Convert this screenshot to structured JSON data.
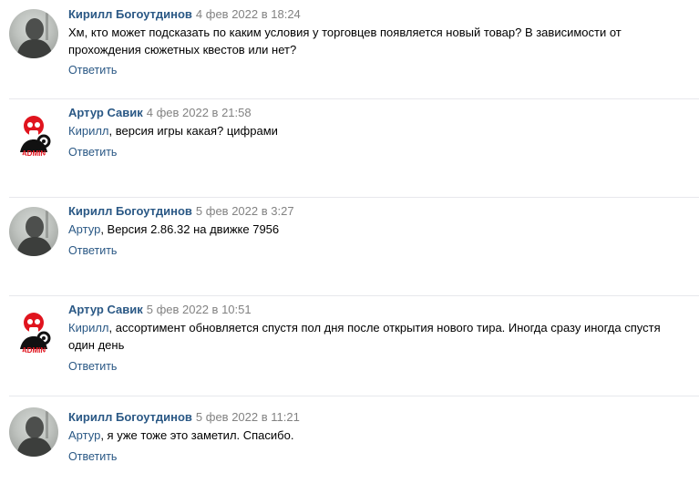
{
  "reply_label": "Ответить",
  "comments": [
    {
      "author": "Кирилл Богоутдинов",
      "date": "4 фев 2022 в 18:24",
      "mention": "",
      "text": "Хм, кто может подсказать по каким условия у торговцев появляется новый товар? В зависимости от прохождения сюжетных квестов или нет?",
      "avatar": "user-photo"
    },
    {
      "author": "Артур Савик",
      "date": "4 фев 2022 в 21:58",
      "mention": "Кирилл",
      "text": ", версия игры какая? цифрами",
      "avatar": "admin-logo"
    },
    {
      "author": "Кирилл Богоутдинов",
      "date": "5 фев 2022 в 3:27",
      "mention": "Артур",
      "text": ", Версия 2.86.32 на движке 7956",
      "avatar": "user-photo"
    },
    {
      "author": "Артур Савик",
      "date": "5 фев 2022 в 10:51",
      "mention": "Кирилл",
      "text": ", ассортимент обновляется спустя пол дня после открытия нового тира. Иногда сразу иногда спустя один день",
      "avatar": "admin-logo"
    },
    {
      "author": "Кирилл Богоутдинов",
      "date": "5 фев 2022 в 11:21",
      "mention": "Артур",
      "text": ", я уже тоже это заметил. Спасибо.",
      "avatar": "user-photo"
    }
  ],
  "admin_logo_text": "ADMIN",
  "colors": {
    "link": "#2a5885",
    "date": "#828282",
    "divider": "#e7e8ec",
    "logo_red": "#e0141e"
  }
}
